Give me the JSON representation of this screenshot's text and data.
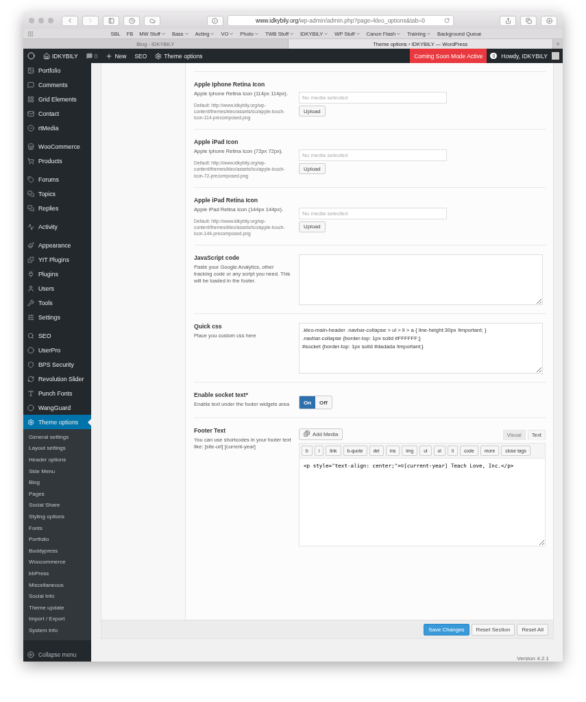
{
  "browser": {
    "url": "**www.idkybily.org**/wp-admin/admin.php?page=kleo_options&tab=0",
    "bookmarks": [
      {
        "label": "SBL",
        "menu": false
      },
      {
        "label": "FB",
        "menu": false
      },
      {
        "label": "MW Stuff",
        "menu": true
      },
      {
        "label": "Bass",
        "menu": true
      },
      {
        "label": "Acting",
        "menu": true
      },
      {
        "label": "VO",
        "menu": true
      },
      {
        "label": "Photo",
        "menu": true
      },
      {
        "label": "TWB Stuff",
        "menu": true
      },
      {
        "label": "IDKYBILY",
        "menu": true
      },
      {
        "label": "WP Stuff",
        "menu": true
      },
      {
        "label": "Canon Flash",
        "menu": true
      },
      {
        "label": "Training",
        "menu": true
      },
      {
        "label": "Background Queue",
        "menu": false
      }
    ],
    "tabs": [
      {
        "title": "Blog - IDKYBILY",
        "selected": false
      },
      {
        "title": "Theme options ‹ IDKYBILY — WordPress",
        "selected": true
      }
    ]
  },
  "admin_bar": {
    "site": "IDKYBILY",
    "comments": "0",
    "new": "New",
    "seo": "SEO",
    "theme_options": "Theme options",
    "coming_soon": "Coming Soon Mode Active",
    "notifications": "0",
    "howdy": "Howdy, IDKYBILY"
  },
  "sidebar": {
    "groups": [
      [
        {
          "label": "Portfolio",
          "selected": false
        },
        {
          "label": "Comments",
          "selected": false
        },
        {
          "label": "Grid Elements",
          "selected": false
        },
        {
          "label": "Contact",
          "selected": false
        },
        {
          "label": "rtMedia",
          "selected": false
        }
      ],
      [
        {
          "label": "WooCommerce",
          "selected": false
        },
        {
          "label": "Products",
          "selected": false
        }
      ],
      [
        {
          "label": "Forums",
          "selected": false
        },
        {
          "label": "Topics",
          "selected": false
        },
        {
          "label": "Replies",
          "selected": false
        }
      ],
      [
        {
          "label": "Activity",
          "selected": false
        }
      ],
      [
        {
          "label": "Appearance",
          "selected": false
        },
        {
          "label": "YIT Plugins",
          "selected": false
        },
        {
          "label": "Plugins",
          "selected": false
        },
        {
          "label": "Users",
          "selected": false
        },
        {
          "label": "Tools",
          "selected": false
        },
        {
          "label": "Settings",
          "selected": false
        }
      ],
      [
        {
          "label": "SEO",
          "selected": false
        },
        {
          "label": "UserPro",
          "selected": false
        },
        {
          "label": "BPS Security",
          "selected": false
        },
        {
          "label": "Revolution Slider",
          "selected": false
        },
        {
          "label": "Punch Fonts",
          "selected": false
        },
        {
          "label": "WangGuard",
          "selected": false
        },
        {
          "label": "Theme options",
          "selected": true
        }
      ]
    ],
    "submenu": [
      "General settings",
      "Layout settings",
      "Header options",
      "Side Menu",
      "Blog",
      "Pages",
      "Social Share",
      "Styling options",
      "Fonts",
      "Portfolio",
      "Buddypress",
      "Woocommerce",
      "bbPress",
      "Miscellaneous",
      "Social Info",
      "Theme update",
      "Import / Export",
      "System Info"
    ],
    "collapse": "Collapse menu"
  },
  "sections": [
    {
      "kind": "upload",
      "title": "Apple Iphone Retina Icon",
      "description": "Apple Iphone Retina Icon (114px 114px).",
      "default": "Default: http://www.idkybily.org/wp-content/themes/kleo/assets/ico/apple-touch-icon-114-precomposed.png",
      "placeholder": "No media selected",
      "button": "Upload"
    },
    {
      "kind": "upload",
      "title": "Apple iPad Icon",
      "description": "Apple Iphone Retina Icon (72px 72px).",
      "default": "Default: http://www.idkybily.org/wp-content/themes/kleo/assets/ico/apple-touch-icon-72-precomposed.png",
      "placeholder": "No media selected",
      "button": "Upload"
    },
    {
      "kind": "upload",
      "title": "Apple iPad Retina Icon",
      "description": "Apple iPad Retina Icon (144px 144px).",
      "default": "Default: http://www.idkybily.org/wp-content/themes/kleo/assets/ico/apple-touch-icon-144-precomposed.png",
      "placeholder": "No media selected",
      "button": "Upload"
    },
    {
      "kind": "textarea",
      "title": "JavaScript code",
      "description": "Paste your Google Analytics, other tracking code or any script you need. This will be loaded in the footer."
    },
    {
      "kind": "textarea",
      "title": "Quick css",
      "description": "Place you custom css here",
      "value": ".kleo-main-header .navbar-collapse > ul > li > a { line-height:30px !important; }\n.navbar-collapse {border-top: 1px solid #FFFFFF;}\n#socket {border-top: 1px solid #dadada !important;}"
    },
    {
      "kind": "toggle",
      "title": "Enable socket text*",
      "description": "Enable text under the footer widgets area",
      "options": [
        {
          "label": "On",
          "selected": true
        },
        {
          "label": "Off",
          "selected": false
        }
      ]
    },
    {
      "kind": "editor",
      "title": "Footer Text",
      "description": "You can use shortcodes in your footer text like: [site-url] [current-year]",
      "add_media": "Add Media",
      "tabs": [
        {
          "label": "Visual",
          "selected": false
        },
        {
          "label": "Text",
          "selected": true
        }
      ],
      "quicktags": [
        "b",
        "i",
        "link",
        "b-quote",
        "del",
        "ins",
        "img",
        "ul",
        "ol",
        "li",
        "code",
        "more",
        "close tags"
      ],
      "value": "<p style=\"text-align: center;\">©[current-year] Teach Love, Inc.</p>"
    }
  ],
  "actions": [
    {
      "label": "Save Changes",
      "primary": true
    },
    {
      "label": "Reset Section",
      "primary": false
    },
    {
      "label": "Reset All",
      "primary": false
    }
  ],
  "version": "Version 4.2.1"
}
